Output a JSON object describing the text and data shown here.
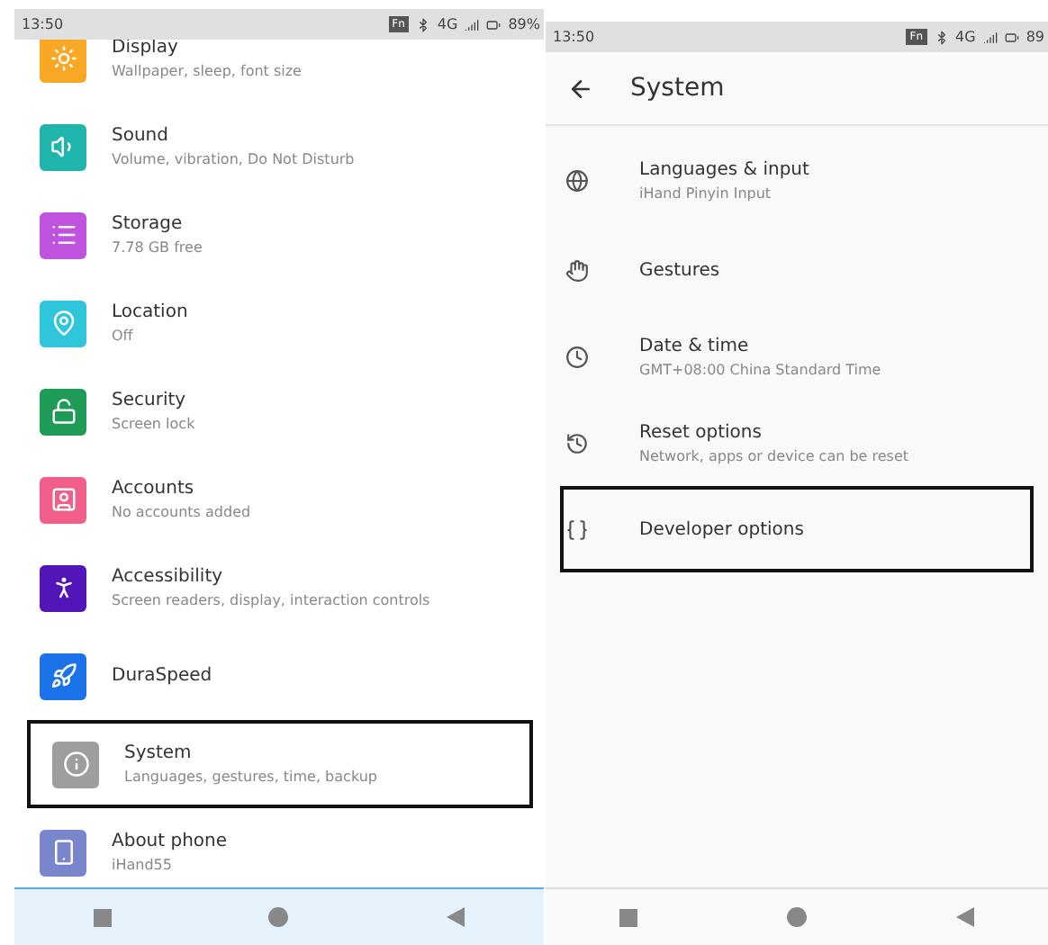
{
  "settings_screen": {
    "status_bar": {
      "time": "13:50",
      "badge": "Fn",
      "network": "4G",
      "battery": "89%"
    },
    "items": [
      {
        "title": "Display",
        "subtitle": "Wallpaper, sleep, font size",
        "color": "#f9a825",
        "highlighted": false
      },
      {
        "title": "Sound",
        "subtitle": "Volume, vibration, Do Not Disturb",
        "color": "#1fb5ac",
        "highlighted": false
      },
      {
        "title": "Storage",
        "subtitle": "7.78 GB free",
        "color": "#c052e0",
        "highlighted": false
      },
      {
        "title": "Location",
        "subtitle": "Off",
        "color": "#2fc6dc",
        "highlighted": false
      },
      {
        "title": "Security",
        "subtitle": "Screen lock",
        "color": "#1e9c57",
        "highlighted": false
      },
      {
        "title": "Accounts",
        "subtitle": "No accounts added",
        "color": "#ef5f8a",
        "highlighted": false
      },
      {
        "title": "Accessibility",
        "subtitle": "Screen readers, display, interaction controls",
        "color": "#5314b8",
        "highlighted": false
      },
      {
        "title": "DuraSpeed",
        "color": "#1a73e8",
        "highlighted": false
      },
      {
        "title": "System",
        "subtitle": "Languages, gestures, time, backup",
        "color": "#9e9e9e",
        "highlighted": true
      },
      {
        "title": "About phone",
        "subtitle": "iHand55",
        "color": "#7986cb",
        "highlighted": false
      }
    ]
  },
  "system_screen": {
    "status_bar": {
      "time": "13:50",
      "badge": "Fn",
      "network": "4G",
      "battery": "89"
    },
    "title": "System",
    "items": [
      {
        "title": "Languages & input",
        "subtitle": "iHand Pinyin Input",
        "highlighted": false
      },
      {
        "title": "Gestures",
        "highlighted": false
      },
      {
        "title": "Date & time",
        "subtitle": "GMT+08:00 China Standard Time",
        "highlighted": false
      },
      {
        "title": "Reset options",
        "subtitle": "Network, apps or device can be reset",
        "highlighted": false
      },
      {
        "title": "Developer options",
        "highlighted": true
      }
    ]
  }
}
